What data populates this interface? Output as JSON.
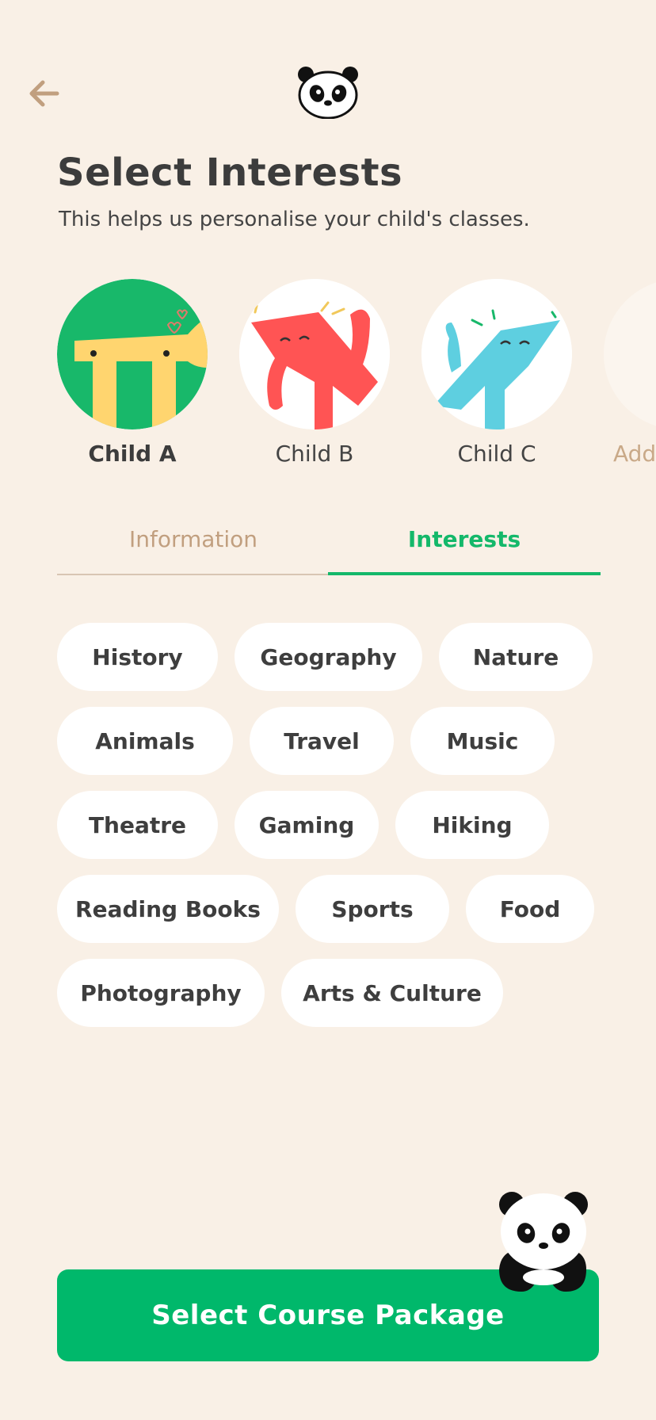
{
  "header": {
    "back_icon": "arrow-left-icon",
    "logo_icon": "panda-logo-icon"
  },
  "page": {
    "title": "Select Interests",
    "subtitle": "This helps us personalise your child's classes."
  },
  "children": [
    {
      "name": "Child A",
      "selected": true,
      "bg": "#18b86a",
      "figure": "#ffd56f"
    },
    {
      "name": "Child B",
      "selected": false,
      "bg": "#ffffff",
      "figure": "#ff5454"
    },
    {
      "name": "Child C",
      "selected": false,
      "bg": "#ffffff",
      "figure": "#5ecfe0"
    },
    {
      "name": "Add",
      "selected": false,
      "bg": "#fbf5ee"
    }
  ],
  "tabs": {
    "information": "Information",
    "interests": "Interests",
    "active": "interests"
  },
  "interests": [
    [
      "History",
      "Geography",
      "Nature"
    ],
    [
      "Animals",
      "Travel",
      "Music"
    ],
    [
      "Theatre",
      "Gaming",
      "Hiking"
    ],
    [
      "Reading Books",
      "Sports",
      "Food"
    ],
    [
      "Photography",
      "Arts & Culture"
    ]
  ],
  "cta": {
    "label": "Select Course Package"
  },
  "colors": {
    "background": "#f9f0e6",
    "accent": "#00b86b",
    "tab_inactive": "#c19f7f"
  }
}
